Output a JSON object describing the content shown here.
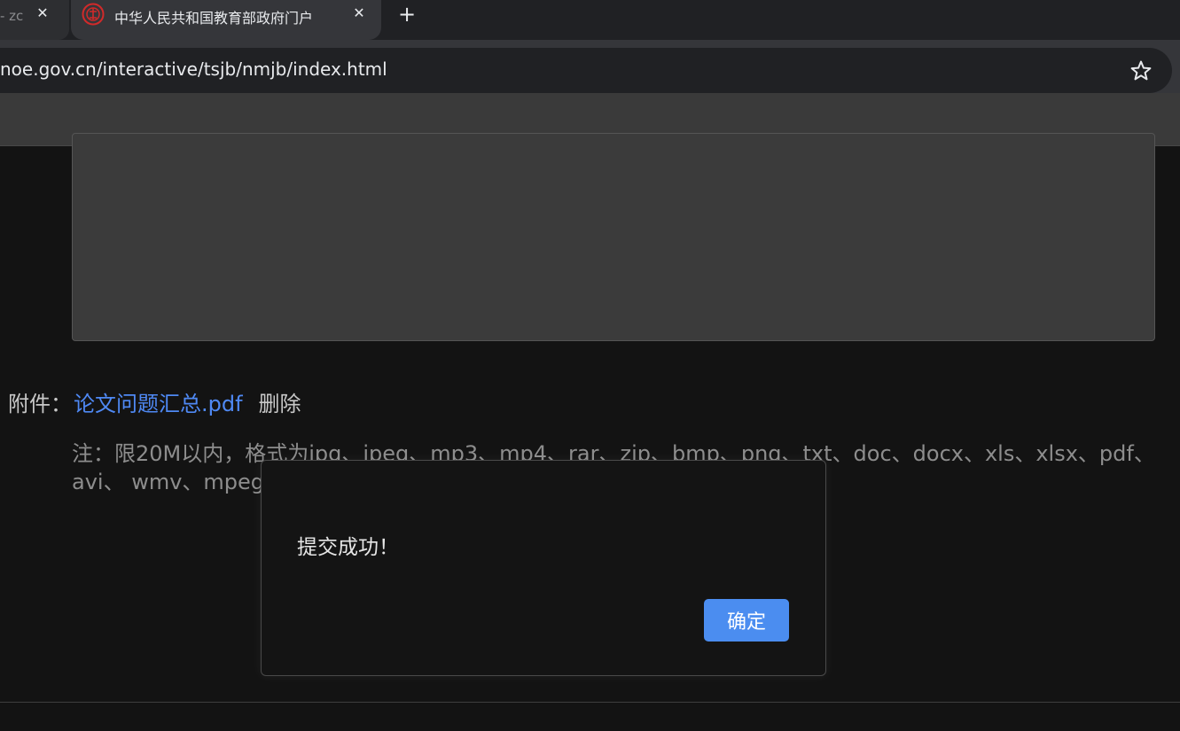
{
  "browser": {
    "tabs": [
      {
        "title": "- zc",
        "active": false
      },
      {
        "title": "中华人民共和国教育部政府门户",
        "active": true
      }
    ],
    "close_glyph": "✕",
    "new_tab_glyph": "+",
    "url": "noe.gov.cn/interactive/tsjb/nmjb/index.html",
    "icons": {
      "favicon": "emblem-icon",
      "bookmark": "star-icon"
    }
  },
  "form": {
    "attachment_label": "附件：",
    "attachment_file": "论文问题汇总.pdf",
    "delete_label": "删除",
    "note": "注：限20M以内，格式为jpg、jpeg、mp3、mp4、rar、zip、bmp、png、txt、doc、docx、xls、xlsx、pdf、avi、 wmv、mpeg、"
  },
  "dialog": {
    "message": "提交成功！",
    "ok_label": "确定"
  },
  "colors": {
    "link": "#4f89f4",
    "button": "#4b8df0",
    "page_bg": "#131313"
  }
}
